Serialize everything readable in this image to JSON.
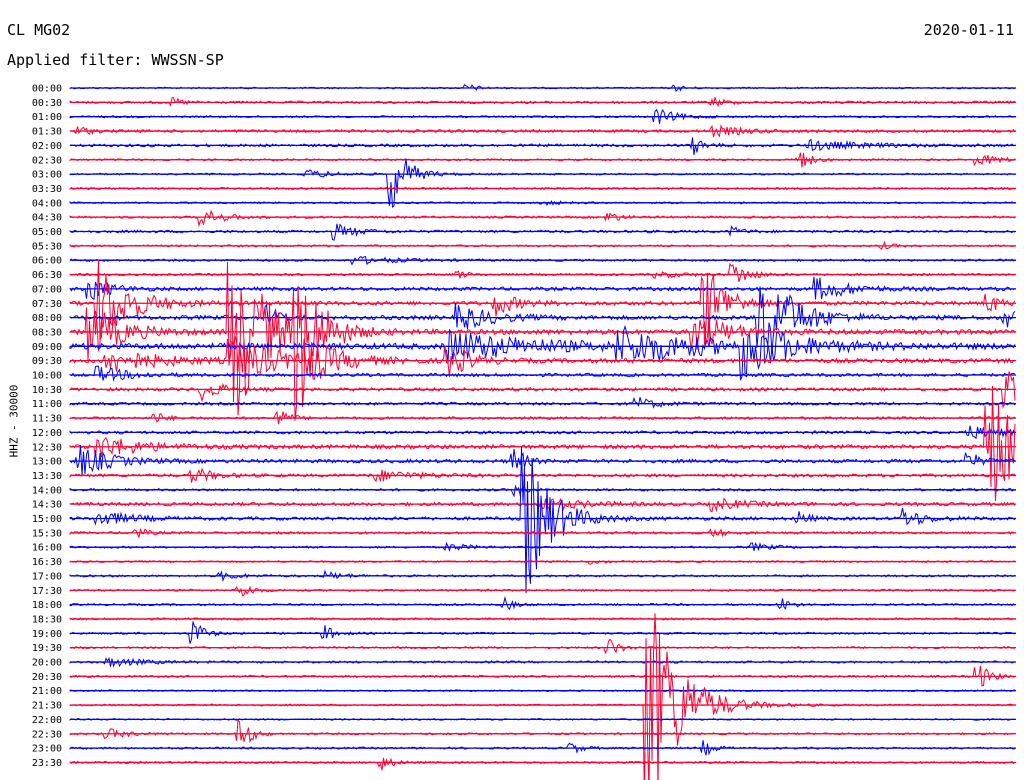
{
  "header": {
    "station": "CL MG02",
    "date": "2020-01-11",
    "filter": "Applied filter: WWSSN-SP"
  },
  "chart_data": {
    "type": "line",
    "title": "CL MG02",
    "subtitle": "Applied filter: WWSSN-SP",
    "ylabel": "HHZ - 30000",
    "xlabel": "",
    "grid": false,
    "legend": "none",
    "colors": [
      "#0000ff",
      "#ff0033"
    ],
    "rows": [
      {
        "time": "00:00",
        "color": "#0000ff",
        "noise": 0.8,
        "events": [
          {
            "at": 0.42,
            "amp": 4,
            "dur": 0.01
          },
          {
            "at": 0.64,
            "amp": 3,
            "dur": 0.01
          }
        ]
      },
      {
        "time": "00:30",
        "color": "#ff0033",
        "noise": 1.2,
        "events": [
          {
            "at": 0.11,
            "amp": 4,
            "dur": 0.01
          },
          {
            "at": 0.68,
            "amp": 6,
            "dur": 0.01
          }
        ]
      },
      {
        "time": "01:00",
        "color": "#0000ff",
        "noise": 1.0,
        "events": [
          {
            "at": 0.62,
            "amp": 8,
            "dur": 0.02
          }
        ]
      },
      {
        "time": "01:30",
        "color": "#ff0033",
        "noise": 1.4,
        "events": [
          {
            "at": 0.01,
            "amp": 5,
            "dur": 0.01
          },
          {
            "at": 0.68,
            "amp": 5,
            "dur": 0.03
          }
        ]
      },
      {
        "time": "02:00",
        "color": "#0000ff",
        "noise": 1.4,
        "events": [
          {
            "at": 0.66,
            "amp": 9,
            "dur": 0.01
          },
          {
            "at": 0.78,
            "amp": 5,
            "dur": 0.05
          }
        ]
      },
      {
        "time": "02:30",
        "color": "#ff0033",
        "noise": 1.0,
        "events": [
          {
            "at": 0.77,
            "amp": 14,
            "dur": 0.01
          },
          {
            "at": 0.96,
            "amp": 6,
            "dur": 0.02
          }
        ]
      },
      {
        "time": "03:00",
        "color": "#0000ff",
        "noise": 0.9,
        "events": [
          {
            "at": 0.34,
            "amp": 40,
            "dur": 0.015
          },
          {
            "at": 0.25,
            "amp": 4,
            "dur": 0.03
          }
        ]
      },
      {
        "time": "03:30",
        "color": "#ff0033",
        "noise": 1.0,
        "events": []
      },
      {
        "time": "04:00",
        "color": "#0000ff",
        "noise": 0.9,
        "events": [
          {
            "at": 0.5,
            "amp": 2,
            "dur": 0.02
          }
        ]
      },
      {
        "time": "04:30",
        "color": "#ff0033",
        "noise": 1.1,
        "events": [
          {
            "at": 0.14,
            "amp": 9,
            "dur": 0.02
          },
          {
            "at": 0.57,
            "amp": 6,
            "dur": 0.01
          }
        ]
      },
      {
        "time": "05:00",
        "color": "#0000ff",
        "noise": 1.3,
        "events": [
          {
            "at": 0.28,
            "amp": 8,
            "dur": 0.02
          },
          {
            "at": 0.7,
            "amp": 5,
            "dur": 0.01
          }
        ]
      },
      {
        "time": "05:30",
        "color": "#ff0033",
        "noise": 1.0,
        "events": [
          {
            "at": 0.86,
            "amp": 3,
            "dur": 0.01
          }
        ]
      },
      {
        "time": "06:00",
        "color": "#0000ff",
        "noise": 1.1,
        "events": [
          {
            "at": 0.3,
            "amp": 4,
            "dur": 0.04
          }
        ]
      },
      {
        "time": "06:30",
        "color": "#ff0033",
        "noise": 1.1,
        "events": [
          {
            "at": 0.7,
            "amp": 14,
            "dur": 0.015
          },
          {
            "at": 0.41,
            "amp": 4,
            "dur": 0.01
          },
          {
            "at": 0.62,
            "amp": 3,
            "dur": 0.03
          }
        ]
      },
      {
        "time": "07:00",
        "color": "#0000ff",
        "noise": 1.8,
        "events": [
          {
            "at": 0.02,
            "amp": 12,
            "dur": 0.02
          },
          {
            "at": 0.79,
            "amp": 12,
            "dur": 0.03
          }
        ]
      },
      {
        "time": "07:30",
        "color": "#ff0033",
        "noise": 2.0,
        "events": [
          {
            "at": 0.03,
            "amp": 45,
            "dur": 0.03
          },
          {
            "at": 0.45,
            "amp": 12,
            "dur": 0.02
          },
          {
            "at": 0.67,
            "amp": 50,
            "dur": 0.02
          },
          {
            "at": 0.97,
            "amp": 12,
            "dur": 0.01
          }
        ]
      },
      {
        "time": "08:00",
        "color": "#0000ff",
        "noise": 2.2,
        "events": [
          {
            "at": 0.21,
            "amp": 14,
            "dur": 0.01
          },
          {
            "at": 0.41,
            "amp": 14,
            "dur": 0.03
          },
          {
            "at": 0.73,
            "amp": 60,
            "dur": 0.03
          },
          {
            "at": 0.99,
            "amp": 10,
            "dur": 0.01
          }
        ]
      },
      {
        "time": "08:30",
        "color": "#ff0033",
        "noise": 2.5,
        "events": [
          {
            "at": 0.02,
            "amp": 30,
            "dur": 0.03
          },
          {
            "at": 0.17,
            "amp": 110,
            "dur": 0.03
          },
          {
            "at": 0.24,
            "amp": 90,
            "dur": 0.02
          },
          {
            "at": 0.66,
            "amp": 22,
            "dur": 0.03
          }
        ]
      },
      {
        "time": "09:00",
        "color": "#0000ff",
        "noise": 3.0,
        "events": [
          {
            "at": 0.4,
            "amp": 16,
            "dur": 0.08
          },
          {
            "at": 0.58,
            "amp": 18,
            "dur": 0.08
          },
          {
            "at": 0.71,
            "amp": 30,
            "dur": 0.04
          }
        ]
      },
      {
        "time": "09:30",
        "color": "#ff0033",
        "noise": 2.2,
        "events": [
          {
            "at": 0.04,
            "amp": 12,
            "dur": 0.05
          },
          {
            "at": 0.17,
            "amp": 28,
            "dur": 0.04
          },
          {
            "at": 0.25,
            "amp": 22,
            "dur": 0.03
          },
          {
            "at": 0.4,
            "amp": 18,
            "dur": 0.02
          }
        ]
      },
      {
        "time": "10:00",
        "color": "#0000ff",
        "noise": 1.6,
        "events": [
          {
            "at": 0.03,
            "amp": 8,
            "dur": 0.03
          }
        ]
      },
      {
        "time": "10:30",
        "color": "#ff0033",
        "noise": 1.6,
        "events": [
          {
            "at": 0.14,
            "amp": 10,
            "dur": 0.02
          },
          {
            "at": 0.99,
            "amp": 30,
            "dur": 0.01
          }
        ]
      },
      {
        "time": "11:00",
        "color": "#0000ff",
        "noise": 1.4,
        "events": [
          {
            "at": 0.6,
            "amp": 6,
            "dur": 0.02
          }
        ]
      },
      {
        "time": "11:30",
        "color": "#ff0033",
        "noise": 1.3,
        "events": [
          {
            "at": 0.09,
            "amp": 6,
            "dur": 0.01
          },
          {
            "at": 0.22,
            "amp": 10,
            "dur": 0.01
          }
        ]
      },
      {
        "time": "12:00",
        "color": "#0000ff",
        "noise": 1.5,
        "events": [
          {
            "at": 0.95,
            "amp": 6,
            "dur": 0.04
          }
        ]
      },
      {
        "time": "12:30",
        "color": "#ff0033",
        "noise": 2.0,
        "events": [
          {
            "at": 0.03,
            "amp": 12,
            "dur": 0.04
          },
          {
            "at": 0.97,
            "amp": 75,
            "dur": 0.03
          }
        ]
      },
      {
        "time": "13:00",
        "color": "#0000ff",
        "noise": 1.8,
        "events": [
          {
            "at": 0.01,
            "amp": 16,
            "dur": 0.03
          },
          {
            "at": 0.47,
            "amp": 16,
            "dur": 0.01
          },
          {
            "at": 0.95,
            "amp": 10,
            "dur": 0.01
          }
        ]
      },
      {
        "time": "13:30",
        "color": "#ff0033",
        "noise": 1.5,
        "events": [
          {
            "at": 0.13,
            "amp": 8,
            "dur": 0.02
          },
          {
            "at": 0.32,
            "amp": 6,
            "dur": 0.04
          }
        ]
      },
      {
        "time": "14:00",
        "color": "#0000ff",
        "noise": 1.2,
        "events": [
          {
            "at": 0.47,
            "amp": 6,
            "dur": 0.01
          }
        ]
      },
      {
        "time": "14:30",
        "color": "#ff0033",
        "noise": 1.7,
        "events": [
          {
            "at": 0.5,
            "amp": 6,
            "dur": 0.04
          },
          {
            "at": 0.68,
            "amp": 6,
            "dur": 0.03
          }
        ]
      },
      {
        "time": "15:00",
        "color": "#0000ff",
        "noise": 1.7,
        "events": [
          {
            "at": 0.03,
            "amp": 8,
            "dur": 0.03
          },
          {
            "at": 0.48,
            "amp": 85,
            "dur": 0.025
          },
          {
            "at": 0.77,
            "amp": 7,
            "dur": 0.01
          },
          {
            "at": 0.88,
            "amp": 10,
            "dur": 0.02
          }
        ]
      },
      {
        "time": "15:30",
        "color": "#ff0033",
        "noise": 1.2,
        "events": [
          {
            "at": 0.07,
            "amp": 6,
            "dur": 0.01
          },
          {
            "at": 0.68,
            "amp": 5,
            "dur": 0.01
          }
        ]
      },
      {
        "time": "16:00",
        "color": "#0000ff",
        "noise": 1.0,
        "events": [
          {
            "at": 0.4,
            "amp": 4,
            "dur": 0.02
          },
          {
            "at": 0.72,
            "amp": 4,
            "dur": 0.02
          }
        ]
      },
      {
        "time": "16:30",
        "color": "#ff0033",
        "noise": 0.9,
        "events": [
          {
            "at": 0.55,
            "amp": 3,
            "dur": 0.01
          }
        ]
      },
      {
        "time": "17:00",
        "color": "#0000ff",
        "noise": 1.0,
        "events": [
          {
            "at": 0.16,
            "amp": 4,
            "dur": 0.02
          },
          {
            "at": 0.27,
            "amp": 4,
            "dur": 0.02
          }
        ]
      },
      {
        "time": "17:30",
        "color": "#ff0033",
        "noise": 1.0,
        "events": [
          {
            "at": 0.18,
            "amp": 10,
            "dur": 0.01
          }
        ]
      },
      {
        "time": "18:00",
        "color": "#0000ff",
        "noise": 1.0,
        "events": [
          {
            "at": 0.46,
            "amp": 6,
            "dur": 0.01
          },
          {
            "at": 0.75,
            "amp": 8,
            "dur": 0.01
          }
        ]
      },
      {
        "time": "18:30",
        "color": "#ff0033",
        "noise": 1.0,
        "events": []
      },
      {
        "time": "19:00",
        "color": "#0000ff",
        "noise": 1.0,
        "events": [
          {
            "at": 0.13,
            "amp": 16,
            "dur": 0.01
          },
          {
            "at": 0.27,
            "amp": 8,
            "dur": 0.01
          }
        ]
      },
      {
        "time": "19:30",
        "color": "#ff0033",
        "noise": 1.0,
        "events": [
          {
            "at": 0.57,
            "amp": 10,
            "dur": 0.01
          }
        ]
      },
      {
        "time": "20:00",
        "color": "#0000ff",
        "noise": 1.1,
        "events": [
          {
            "at": 0.04,
            "amp": 5,
            "dur": 0.03
          }
        ]
      },
      {
        "time": "20:30",
        "color": "#ff0033",
        "noise": 1.0,
        "events": [
          {
            "at": 0.96,
            "amp": 16,
            "dur": 0.01
          }
        ]
      },
      {
        "time": "21:00",
        "color": "#0000ff",
        "noise": 0.8,
        "events": []
      },
      {
        "time": "21:30",
        "color": "#ff0033",
        "noise": 0.9,
        "events": [
          {
            "at": 0.61,
            "amp": 130,
            "dur": 0.03
          }
        ]
      },
      {
        "time": "22:00",
        "color": "#0000ff",
        "noise": 0.8,
        "events": []
      },
      {
        "time": "22:30",
        "color": "#ff0033",
        "noise": 1.0,
        "events": [
          {
            "at": 0.04,
            "amp": 5,
            "dur": 0.02
          },
          {
            "at": 0.18,
            "amp": 20,
            "dur": 0.01
          }
        ]
      },
      {
        "time": "23:00",
        "color": "#0000ff",
        "noise": 1.0,
        "events": [
          {
            "at": 0.53,
            "amp": 6,
            "dur": 0.01
          },
          {
            "at": 0.67,
            "amp": 8,
            "dur": 0.01
          }
        ]
      },
      {
        "time": "23:30",
        "color": "#ff0033",
        "noise": 1.0,
        "events": [
          {
            "at": 0.33,
            "amp": 8,
            "dur": 0.01
          }
        ]
      }
    ]
  }
}
